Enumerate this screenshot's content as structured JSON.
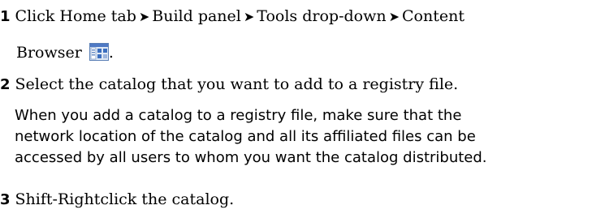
{
  "steps": [
    {
      "number": "1",
      "parts": [
        "Click Home tab",
        "Build panel",
        "Tools drop-down",
        "Content"
      ],
      "continuation": "Browser",
      "trailing": ".",
      "icon": "content-browser-icon"
    },
    {
      "number": "2",
      "text": "Select the catalog that you want to add to a registry file.",
      "note_lines": [
        "When you add a catalog to a registry file, make sure that the",
        "network location of the catalog and all its affiliated files can be",
        "accessed by all users to whom you want the catalog distributed."
      ]
    },
    {
      "number": "3",
      "text": "Shift-Rightclick the catalog."
    }
  ],
  "separator_glyph": "➤"
}
